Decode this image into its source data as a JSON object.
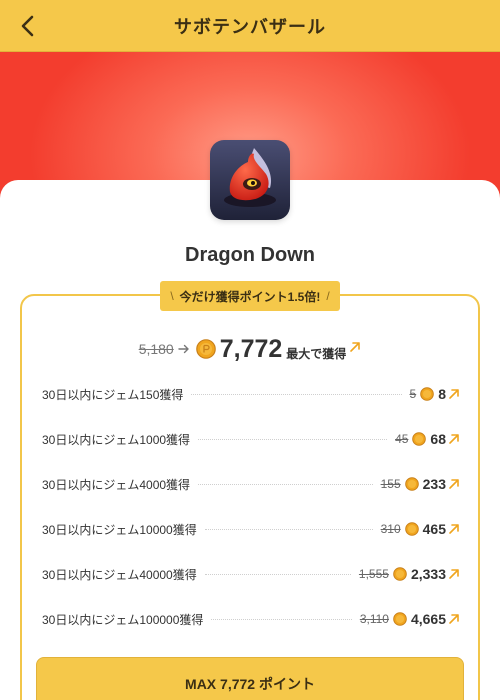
{
  "header": {
    "title": "サボテンバザール"
  },
  "app": {
    "name": "Dragon Down"
  },
  "promo": {
    "text": "今だけ獲得ポイント1.5倍!",
    "slash_left": "\\",
    "slash_right": "/"
  },
  "summary": {
    "old_total": "5,180",
    "new_total": "7,772",
    "max_label": "最大で獲得"
  },
  "tasks": [
    {
      "label": "30日以内にジェム150獲得",
      "old": "5",
      "new": "8"
    },
    {
      "label": "30日以内にジェム1000獲得",
      "old": "45",
      "new": "68"
    },
    {
      "label": "30日以内にジェム4000獲得",
      "old": "155",
      "new": "233"
    },
    {
      "label": "30日以内にジェム10000獲得",
      "old": "310",
      "new": "465"
    },
    {
      "label": "30日以内にジェム40000獲得",
      "old": "1,555",
      "new": "2,333"
    },
    {
      "label": "30日以内にジェム100000獲得",
      "old": "3,110",
      "new": "4,665"
    }
  ],
  "cta": {
    "label": "MAX 7,772 ポイント"
  },
  "colors": {
    "accent": "#f5c84a",
    "hero": "#f33d2e",
    "coin": "#f0a51e"
  },
  "icons": {
    "back": "chevron-left-icon",
    "coin": "coin-icon",
    "up": "arrow-up-right-icon",
    "arrow": "arrow-right-icon"
  }
}
